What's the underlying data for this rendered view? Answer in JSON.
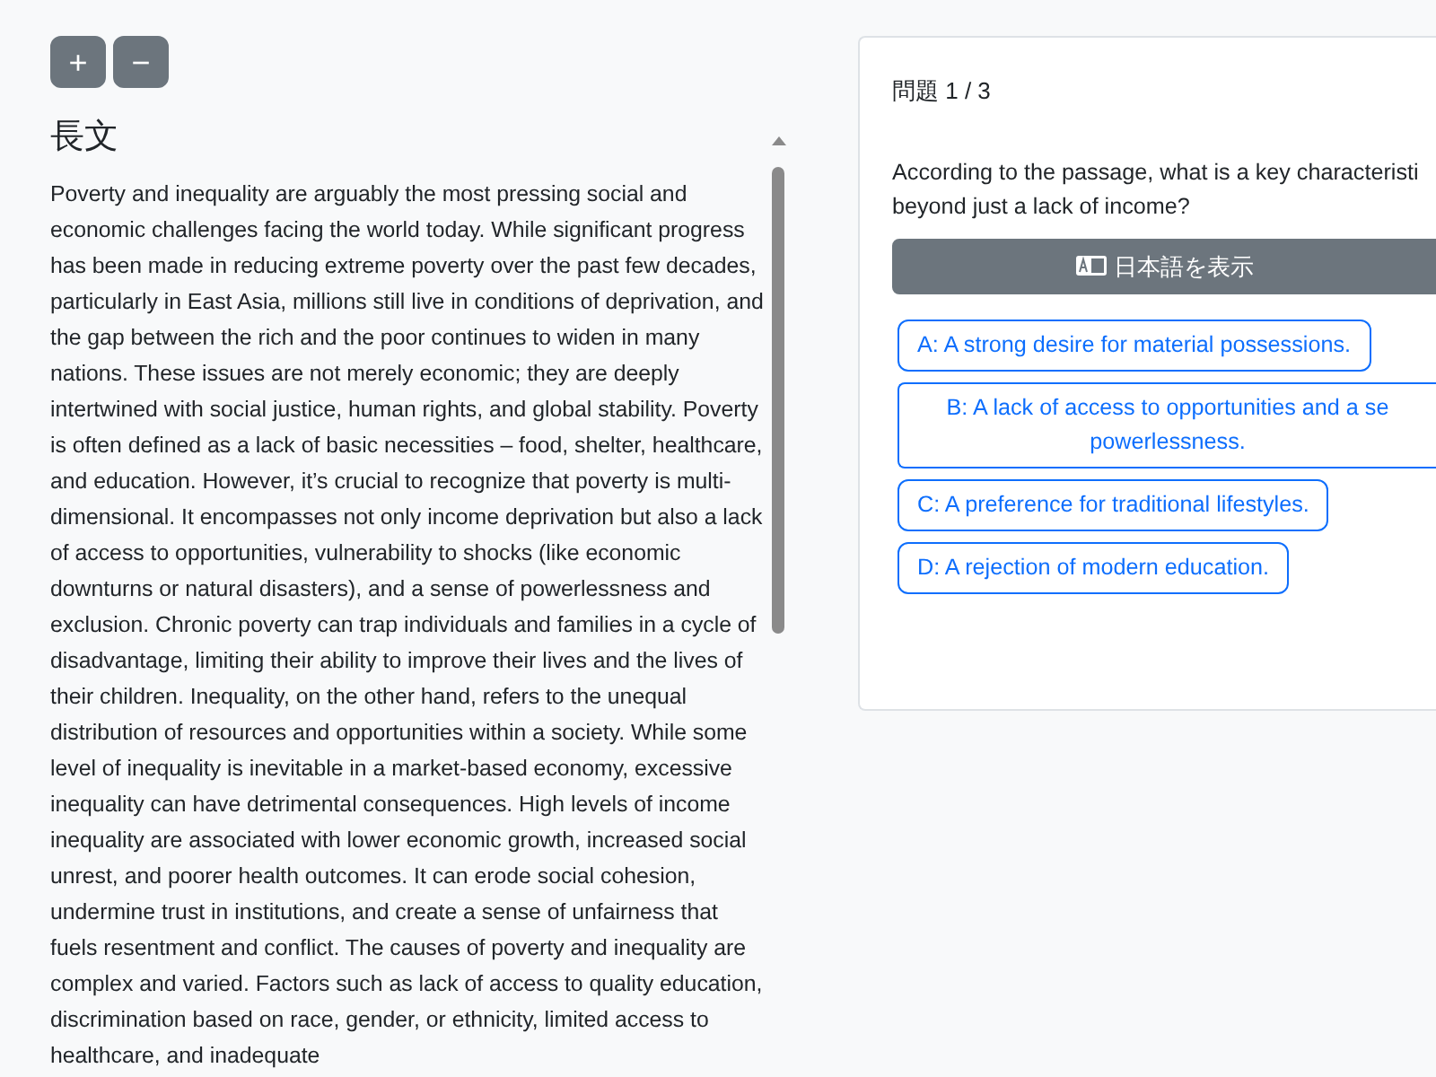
{
  "zoom_buttons": [
    "+",
    "−"
  ],
  "passage": {
    "title": "長文",
    "text": "Poverty and inequality are arguably the most pressing social and economic challenges facing the world today. While significant progress has been made in reducing extreme poverty over the past few decades, particularly in East Asia, millions still live in conditions of deprivation, and the gap between the rich and the poor continues to widen in many nations. These issues are not merely economic; they are deeply intertwined with social justice, human rights, and global stability. Poverty is often defined as a lack of basic necessities – food, shelter, healthcare, and education. However, it’s crucial to recognize that poverty is multi-dimensional. It encompasses not only income deprivation but also a lack of access to opportunities, vulnerability to shocks (like economic downturns or natural disasters), and a sense of powerlessness and exclusion. Chronic poverty can trap individuals and families in a cycle of disadvantage, limiting their ability to improve their lives and the lives of their children. Inequality, on the other hand, refers to the unequal distribution of resources and opportunities within a society. While some level of inequality is inevitable in a market-based economy, excessive inequality can have detrimental consequences. High levels of income inequality are associated with lower economic growth, increased social unrest, and poorer health outcomes. It can erode social cohesion, undermine trust in institutions, and create a sense of unfairness that fuels resentment and conflict. The causes of poverty and inequality are complex and varied. Factors such as lack of access to quality education, discrimination based on race, gender, or ethnicity, limited access to healthcare, and inadequate"
  },
  "question": {
    "counter": "問題 1 / 3",
    "lines": [
      "According to the passage, what is a key characteristi",
      "beyond just a lack of income?"
    ],
    "translate_button": "日本語を表示",
    "options": [
      {
        "lines": [
          "A: A strong desire for material possessions."
        ]
      },
      {
        "lines": [
          "B: A lack of access to opportunities and a se",
          "powerlessness."
        ]
      },
      {
        "lines": [
          "C: A preference for traditional lifestyles."
        ]
      },
      {
        "lines": [
          "D: A rejection of modern education."
        ]
      }
    ]
  }
}
